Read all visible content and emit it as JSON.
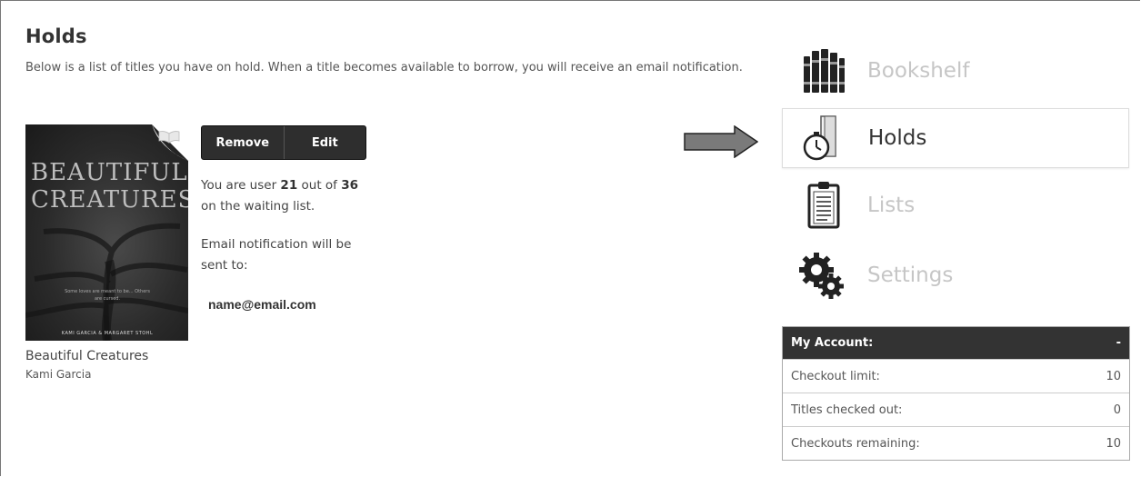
{
  "page": {
    "title": "Holds",
    "intro": "Below is a list of titles you have on hold. When a title becomes available to borrow, you will receive an email notification."
  },
  "hold": {
    "cover": {
      "title_line1": "BEAUTIFUL",
      "title_line2": "CREATURES",
      "tagline": "Some loves are meant to be... Others are cursed.",
      "authors": "KAMI GARCIA & MARGARET STOHL"
    },
    "book_title": "Beautiful Creatures",
    "author": "Kami Garcia",
    "buttons": {
      "remove": "Remove",
      "edit": "Edit"
    },
    "position_prefix": "You are user ",
    "position": "21",
    "position_mid": " out of ",
    "total": "36",
    "position_suffix": " on the waiting list.",
    "notification_text": "Email notification will be sent to:",
    "email": "name@email.com"
  },
  "nav": {
    "items": [
      {
        "label": "Bookshelf",
        "icon": "bookshelf-icon",
        "active": false
      },
      {
        "label": "Holds",
        "icon": "holds-icon",
        "active": true
      },
      {
        "label": "Lists",
        "icon": "lists-icon",
        "active": false
      },
      {
        "label": "Settings",
        "icon": "settings-icon",
        "active": false
      }
    ]
  },
  "account": {
    "header": "My Account:",
    "toggle": "-",
    "rows": [
      {
        "label": "Checkout limit:",
        "value": "10"
      },
      {
        "label": "Titles checked out:",
        "value": "0"
      },
      {
        "label": "Checkouts remaining:",
        "value": "10"
      }
    ]
  }
}
